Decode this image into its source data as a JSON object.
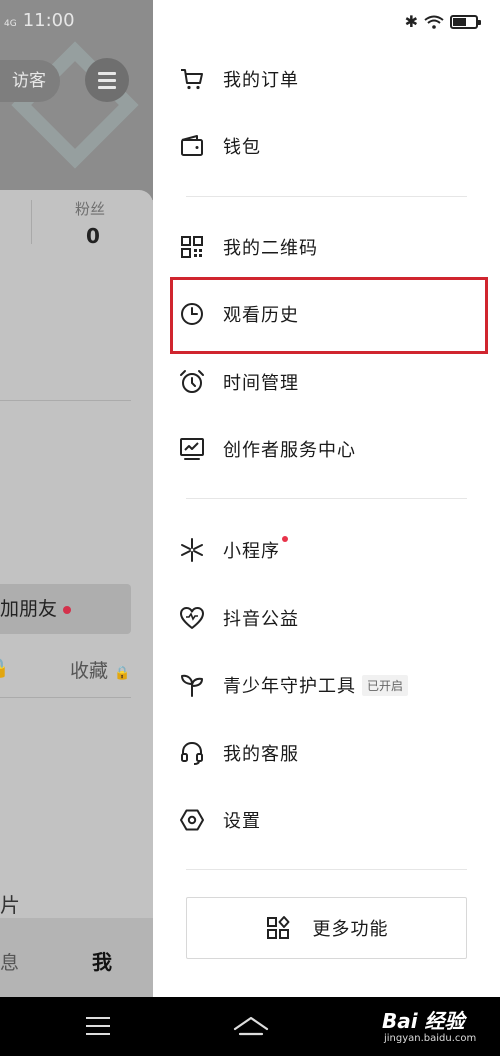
{
  "status_bar": {
    "network": "4G",
    "time": "11:00"
  },
  "background": {
    "visitor_label": "访客",
    "fans_label": "粉丝",
    "fans_count": "0",
    "add_friend_label": "加朋友",
    "collect_label": "收藏",
    "photo_label": "片",
    "message_tab_label": "息",
    "me_tab_label": "我"
  },
  "drawer": {
    "group1": [
      {
        "id": "orders",
        "label": "我的订单",
        "icon": "cart-icon"
      },
      {
        "id": "wallet",
        "label": "钱包",
        "icon": "wallet-icon"
      }
    ],
    "group2": [
      {
        "id": "qrcode",
        "label": "我的二维码",
        "icon": "qr-code-icon"
      },
      {
        "id": "history",
        "label": "观看历史",
        "icon": "clock-icon"
      },
      {
        "id": "time",
        "label": "时间管理",
        "icon": "alarm-icon"
      },
      {
        "id": "creator",
        "label": "创作者服务中心",
        "icon": "chart-monitor-icon"
      }
    ],
    "group3": [
      {
        "id": "miniapp",
        "label": "小程序",
        "icon": "miniapp-icon"
      },
      {
        "id": "charity",
        "label": "抖音公益",
        "icon": "heart-icon"
      },
      {
        "id": "teen",
        "label": "青少年守护工具",
        "icon": "sprout-icon",
        "tag": "已开启"
      },
      {
        "id": "service",
        "label": "我的客服",
        "icon": "headset-icon"
      },
      {
        "id": "settings",
        "label": "设置",
        "icon": "settings-hex-icon"
      }
    ],
    "more_label": "更多功能"
  },
  "watermark": {
    "main": "Bai 经验",
    "sub": "jingyan.baidu.com"
  },
  "colors": {
    "highlight": "#d0252f",
    "red_dot": "#e8334a"
  }
}
